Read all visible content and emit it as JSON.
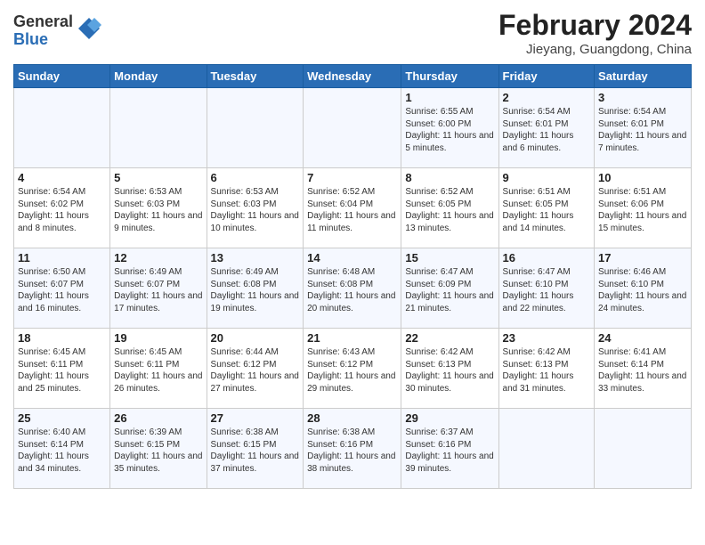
{
  "header": {
    "logo_general": "General",
    "logo_blue": "Blue",
    "month_year": "February 2024",
    "location": "Jieyang, Guangdong, China"
  },
  "days_of_week": [
    "Sunday",
    "Monday",
    "Tuesday",
    "Wednesday",
    "Thursday",
    "Friday",
    "Saturday"
  ],
  "weeks": [
    [
      {
        "day": "",
        "info": ""
      },
      {
        "day": "",
        "info": ""
      },
      {
        "day": "",
        "info": ""
      },
      {
        "day": "",
        "info": ""
      },
      {
        "day": "1",
        "info": "Sunrise: 6:55 AM\nSunset: 6:00 PM\nDaylight: 11 hours and 5 minutes."
      },
      {
        "day": "2",
        "info": "Sunrise: 6:54 AM\nSunset: 6:01 PM\nDaylight: 11 hours and 6 minutes."
      },
      {
        "day": "3",
        "info": "Sunrise: 6:54 AM\nSunset: 6:01 PM\nDaylight: 11 hours and 7 minutes."
      }
    ],
    [
      {
        "day": "4",
        "info": "Sunrise: 6:54 AM\nSunset: 6:02 PM\nDaylight: 11 hours and 8 minutes."
      },
      {
        "day": "5",
        "info": "Sunrise: 6:53 AM\nSunset: 6:03 PM\nDaylight: 11 hours and 9 minutes."
      },
      {
        "day": "6",
        "info": "Sunrise: 6:53 AM\nSunset: 6:03 PM\nDaylight: 11 hours and 10 minutes."
      },
      {
        "day": "7",
        "info": "Sunrise: 6:52 AM\nSunset: 6:04 PM\nDaylight: 11 hours and 11 minutes."
      },
      {
        "day": "8",
        "info": "Sunrise: 6:52 AM\nSunset: 6:05 PM\nDaylight: 11 hours and 13 minutes."
      },
      {
        "day": "9",
        "info": "Sunrise: 6:51 AM\nSunset: 6:05 PM\nDaylight: 11 hours and 14 minutes."
      },
      {
        "day": "10",
        "info": "Sunrise: 6:51 AM\nSunset: 6:06 PM\nDaylight: 11 hours and 15 minutes."
      }
    ],
    [
      {
        "day": "11",
        "info": "Sunrise: 6:50 AM\nSunset: 6:07 PM\nDaylight: 11 hours and 16 minutes."
      },
      {
        "day": "12",
        "info": "Sunrise: 6:49 AM\nSunset: 6:07 PM\nDaylight: 11 hours and 17 minutes."
      },
      {
        "day": "13",
        "info": "Sunrise: 6:49 AM\nSunset: 6:08 PM\nDaylight: 11 hours and 19 minutes."
      },
      {
        "day": "14",
        "info": "Sunrise: 6:48 AM\nSunset: 6:08 PM\nDaylight: 11 hours and 20 minutes."
      },
      {
        "day": "15",
        "info": "Sunrise: 6:47 AM\nSunset: 6:09 PM\nDaylight: 11 hours and 21 minutes."
      },
      {
        "day": "16",
        "info": "Sunrise: 6:47 AM\nSunset: 6:10 PM\nDaylight: 11 hours and 22 minutes."
      },
      {
        "day": "17",
        "info": "Sunrise: 6:46 AM\nSunset: 6:10 PM\nDaylight: 11 hours and 24 minutes."
      }
    ],
    [
      {
        "day": "18",
        "info": "Sunrise: 6:45 AM\nSunset: 6:11 PM\nDaylight: 11 hours and 25 minutes."
      },
      {
        "day": "19",
        "info": "Sunrise: 6:45 AM\nSunset: 6:11 PM\nDaylight: 11 hours and 26 minutes."
      },
      {
        "day": "20",
        "info": "Sunrise: 6:44 AM\nSunset: 6:12 PM\nDaylight: 11 hours and 27 minutes."
      },
      {
        "day": "21",
        "info": "Sunrise: 6:43 AM\nSunset: 6:12 PM\nDaylight: 11 hours and 29 minutes."
      },
      {
        "day": "22",
        "info": "Sunrise: 6:42 AM\nSunset: 6:13 PM\nDaylight: 11 hours and 30 minutes."
      },
      {
        "day": "23",
        "info": "Sunrise: 6:42 AM\nSunset: 6:13 PM\nDaylight: 11 hours and 31 minutes."
      },
      {
        "day": "24",
        "info": "Sunrise: 6:41 AM\nSunset: 6:14 PM\nDaylight: 11 hours and 33 minutes."
      }
    ],
    [
      {
        "day": "25",
        "info": "Sunrise: 6:40 AM\nSunset: 6:14 PM\nDaylight: 11 hours and 34 minutes."
      },
      {
        "day": "26",
        "info": "Sunrise: 6:39 AM\nSunset: 6:15 PM\nDaylight: 11 hours and 35 minutes."
      },
      {
        "day": "27",
        "info": "Sunrise: 6:38 AM\nSunset: 6:15 PM\nDaylight: 11 hours and 37 minutes."
      },
      {
        "day": "28",
        "info": "Sunrise: 6:38 AM\nSunset: 6:16 PM\nDaylight: 11 hours and 38 minutes."
      },
      {
        "day": "29",
        "info": "Sunrise: 6:37 AM\nSunset: 6:16 PM\nDaylight: 11 hours and 39 minutes."
      },
      {
        "day": "",
        "info": ""
      },
      {
        "day": "",
        "info": ""
      }
    ]
  ]
}
